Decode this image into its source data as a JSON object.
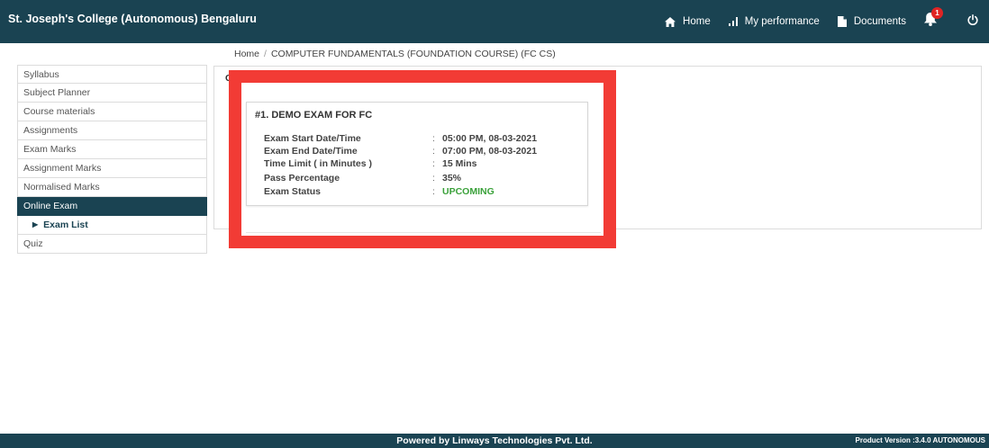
{
  "header": {
    "brand": "St. Joseph's College (Autonomous) Bengaluru",
    "nav": {
      "home": "Home",
      "performance": "My performance",
      "documents": "Documents"
    },
    "notification_count": "1",
    "icons": [
      "home-icon",
      "bar-chart-icon",
      "document-icon",
      "bell-icon",
      "power-icon"
    ]
  },
  "breadcrumb": {
    "home": "Home",
    "separator": "/",
    "current": "COMPUTER FUNDAMENTALS (FOUNDATION COURSE) (FC CS)"
  },
  "sidebar": {
    "items": [
      {
        "label": "Syllabus"
      },
      {
        "label": "Subject Planner"
      },
      {
        "label": "Course materials"
      },
      {
        "label": "Assignments"
      },
      {
        "label": "Exam Marks"
      },
      {
        "label": "Assignment Marks"
      },
      {
        "label": "Normalised Marks"
      },
      {
        "label": "Online Exam"
      },
      {
        "label": "Exam List"
      },
      {
        "label": "Quiz"
      }
    ]
  },
  "panel": {
    "heading_letter": "C"
  },
  "exam": {
    "title": "#1. DEMO EXAM FOR FC",
    "rows": [
      {
        "label": "Exam Start Date/Time",
        "value": "05:00 PM, 08-03-2021"
      },
      {
        "label": "Exam End Date/Time",
        "value": "07:00 PM, 08-03-2021"
      },
      {
        "label": "Time Limit ( in Minutes )",
        "value": "15 Mins"
      },
      {
        "label": "Pass Percentage",
        "value": "35%"
      },
      {
        "label": "Exam Status",
        "value": "UPCOMING"
      }
    ],
    "colon": ":"
  },
  "footer": {
    "powered_by": "Powered by Linways Technologies Pvt. Ltd.",
    "version": "Product Version :3.4.0 AUTONOMOUS"
  },
  "colors": {
    "primary": "#1a4352",
    "highlight": "#f23b35",
    "status_upcoming": "#3aa13a"
  }
}
